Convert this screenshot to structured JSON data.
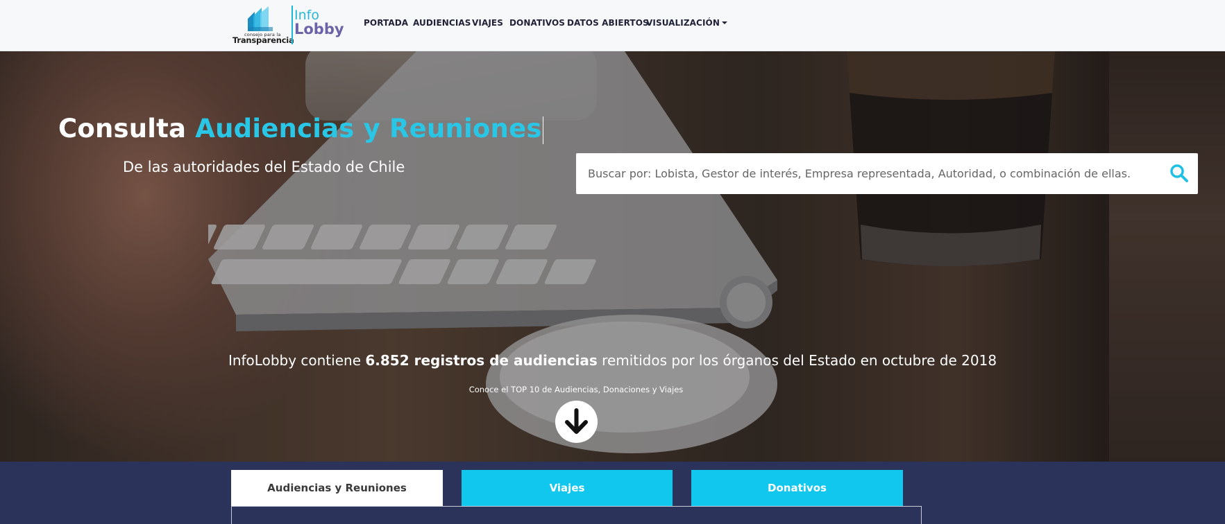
{
  "brand": {
    "org_small": "consejo para la",
    "org_big": "Transparencia",
    "info": "Info",
    "lobby": "Lobby"
  },
  "nav": {
    "items": [
      {
        "label": "PORTADA"
      },
      {
        "label": "AUDIENCIAS"
      },
      {
        "label": "VIAJES"
      },
      {
        "label": "DONATIVOS"
      },
      {
        "label": "DATOS ABIERTOS"
      },
      {
        "label": "VISUALIZACIÓN",
        "dropdown": true
      }
    ]
  },
  "hero": {
    "title_prefix": "Consulta ",
    "title_accent": "Audiencias y Reuniones",
    "subtitle": "De las autoridades del Estado de Chile",
    "search_placeholder": "Buscar por: Lobista, Gestor de interés, Empresa representada, Autoridad, o combinación de ellas.",
    "search_icon": "search-icon",
    "stats_prefix": "InfoLobby contiene ",
    "stats_bold": "6.852 registros de audiencias",
    "stats_suffix": " remitidos por los órganos del Estado en octubre de 2018",
    "top10_text": "Conoce el TOP 10 de Audiencias, Donaciones y Viajes",
    "down_icon": "arrow-down-circle-icon"
  },
  "tabs": [
    {
      "label": "Audiencias y Reuniones",
      "active": true
    },
    {
      "label": "Viajes",
      "active": false
    },
    {
      "label": "Donativos",
      "active": false
    }
  ],
  "colors": {
    "accent": "#2ac6e6",
    "tab_inactive": "#12c7ee",
    "dark_band": "#2b335b",
    "lobby_purple": "#6a63a8"
  }
}
